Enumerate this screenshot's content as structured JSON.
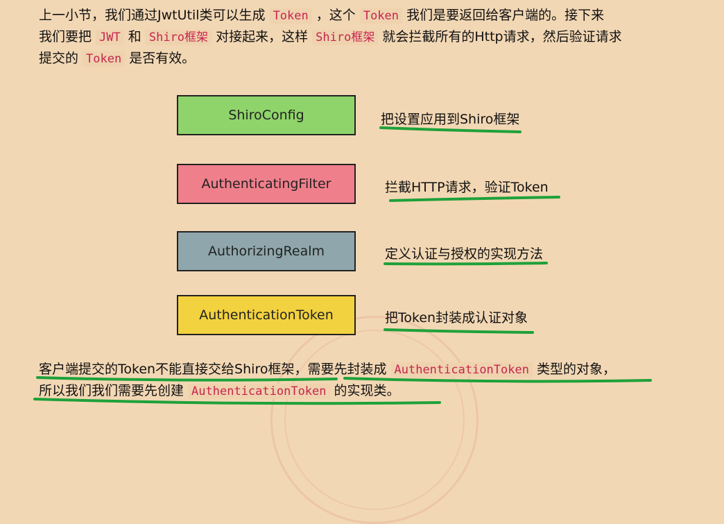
{
  "intro": {
    "line1": [
      "上一小节，我们通过JwtUtil类可以生成 ",
      "Token",
      " ，这个 ",
      "Token",
      " 我们是要返回给客户端的。接下来"
    ],
    "line2": [
      "我们要把 ",
      "JWT",
      " 和 ",
      "Shiro框架",
      " 对接起来，这样 ",
      "Shiro框架",
      " 就会拦截所有的Http请求，然后验证请求"
    ],
    "line3": [
      "提交的 ",
      "Token",
      " 是否有效。"
    ]
  },
  "boxes": [
    {
      "label": "ShiroConfig",
      "color": "#8fd46a",
      "note": "把设置应用到Shiro框架"
    },
    {
      "label": "AuthenticatingFilter",
      "color": "#f07f8c",
      "note": "拦截HTTP请求，验证Token"
    },
    {
      "label": "AuthorizingRealm",
      "color": "#8fa7ac",
      "note": "定义认证与授权的实现方法"
    },
    {
      "label": "AuthenticationToken",
      "color": "#f3d23f",
      "note": "把Token封装成认证对象"
    }
  ],
  "outro": {
    "line1": [
      "客户端提交的Token不能直接交给Shiro框架，需要先封装成 ",
      "AuthenticationToken",
      " 类型的对象，"
    ],
    "line2": [
      "所以我们我们需要先创建 ",
      "AuthenticationToken",
      " 的实现类。"
    ]
  },
  "underline_color": "#1ea13a"
}
